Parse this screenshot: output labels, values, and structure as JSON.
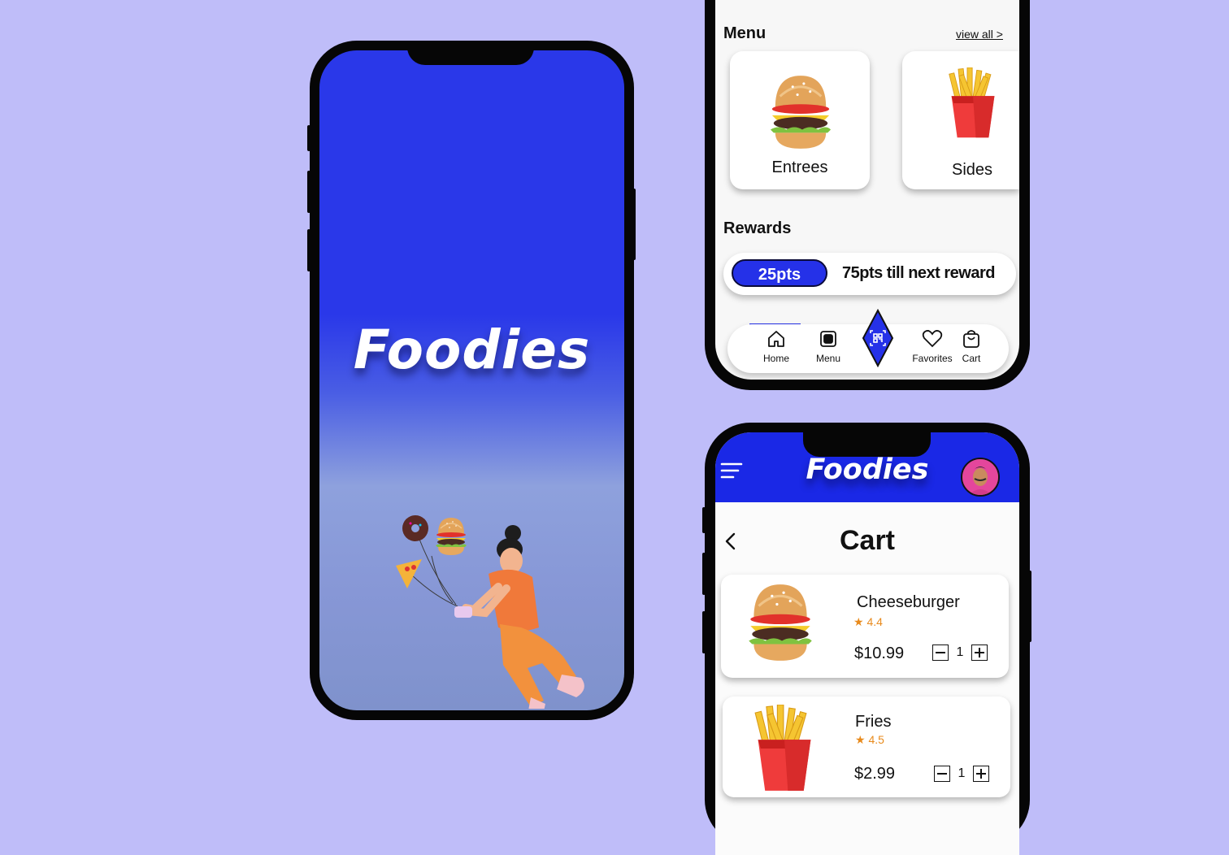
{
  "colors": {
    "background": "#bfbdf9",
    "brand_blue": "#2531e8",
    "rating": "#e88a1c"
  },
  "splash": {
    "logo": "Foodies"
  },
  "home": {
    "menu_title": "Menu",
    "view_all": "view all >",
    "categories": [
      {
        "label": "Entrees",
        "icon": "burger-image"
      },
      {
        "label": "Sides",
        "icon": "fries-image"
      }
    ],
    "rewards_title": "Rewards",
    "points": "25pts",
    "next_reward": "75pts till next reward",
    "tabs": [
      {
        "label": "Home",
        "icon": "home-icon",
        "active": true
      },
      {
        "label": "Menu",
        "icon": "menu-book-icon"
      },
      {
        "label": "",
        "icon": "qr-scan-icon"
      },
      {
        "label": "Favorites",
        "icon": "heart-icon"
      },
      {
        "label": "Cart",
        "icon": "shopping-bag-icon"
      }
    ]
  },
  "cart": {
    "logo": "Foodies",
    "title": "Cart",
    "items": [
      {
        "name": "Cheeseburger",
        "rating": "4.4",
        "price": "$10.99",
        "qty": "1"
      },
      {
        "name": "Fries",
        "rating": "4.5",
        "price": "$2.99",
        "qty": "1"
      }
    ]
  }
}
